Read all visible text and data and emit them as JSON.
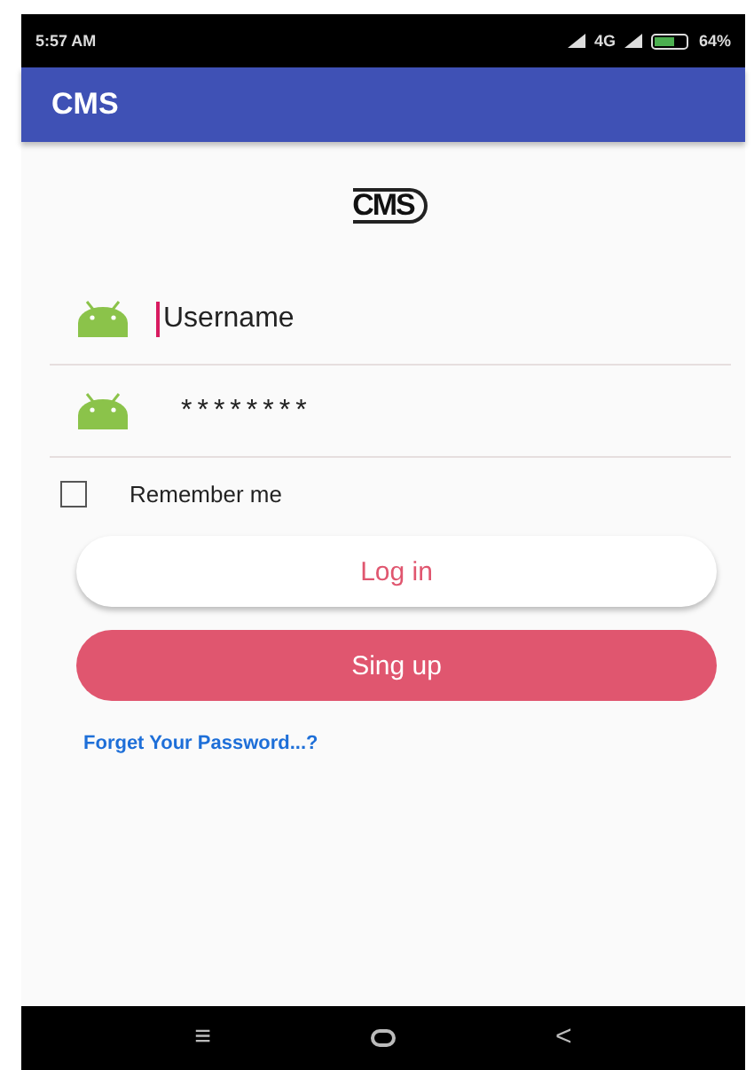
{
  "status_bar": {
    "time": "5:57 AM",
    "network": "4G",
    "battery": "64%"
  },
  "app_bar": {
    "title": "CMS"
  },
  "logo": {
    "text": "CMS"
  },
  "fields": [
    {
      "kind": "text",
      "placeholder": "Username",
      "focused": true
    },
    {
      "kind": "password",
      "value": "********",
      "focused": false
    }
  ],
  "remember": {
    "label": "Remember me",
    "checked": false
  },
  "buttons": [
    {
      "kind": "outlined",
      "label": "Log in"
    },
    {
      "kind": "filled",
      "label": "Sing up"
    }
  ],
  "forgot_link": "Forget Your Password...?",
  "nav_bar": {
    "menu": "≡",
    "back": "<"
  }
}
